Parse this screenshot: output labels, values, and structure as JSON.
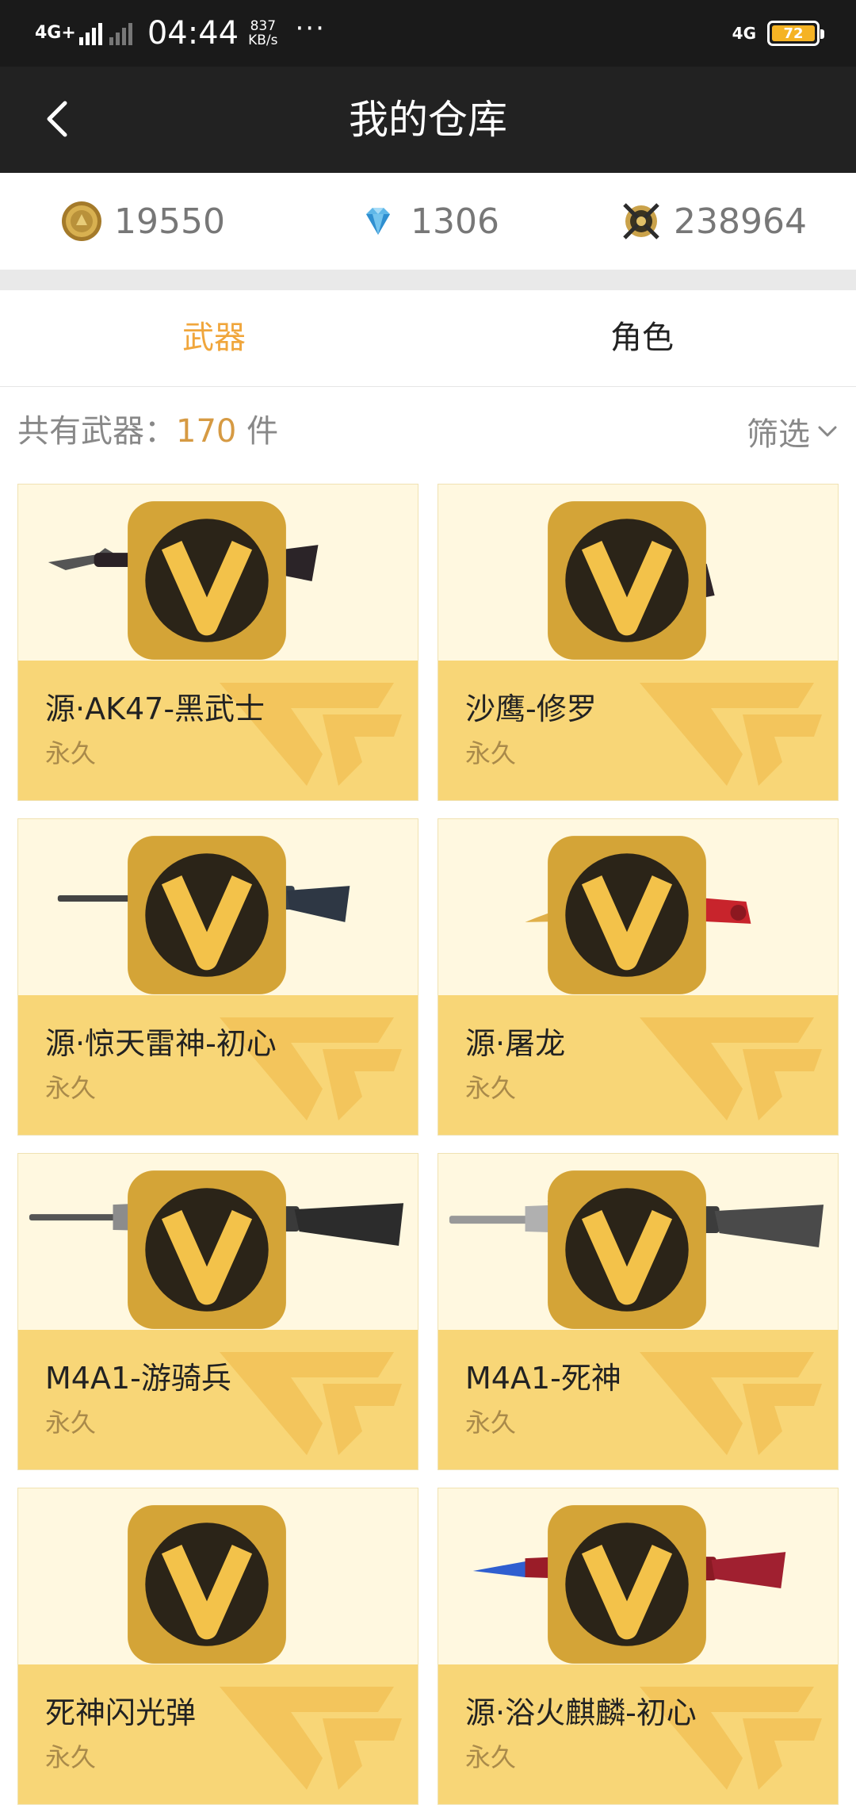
{
  "status_bar": {
    "network": "4G+",
    "time": "04:44",
    "speed_value": "837",
    "speed_unit": "KB/s",
    "dots": "···",
    "network_right": "4G",
    "battery": "72"
  },
  "header": {
    "title": "我的仓库",
    "back_icon": "chevron-left-icon"
  },
  "currency": [
    {
      "icon": "gold-coin-icon",
      "value": "19550"
    },
    {
      "icon": "diamond-icon",
      "value": "1306"
    },
    {
      "icon": "crossed-swords-emblem-icon",
      "value": "238964"
    }
  ],
  "tabs": [
    {
      "label": "武器",
      "active": true
    },
    {
      "label": "角色",
      "active": false
    }
  ],
  "summary": {
    "prefix": "共有武器：",
    "count": "170",
    "suffix": " 件"
  },
  "filter": {
    "label": "筛选",
    "icon": "chevron-down-icon"
  },
  "items": [
    {
      "name": "源·AK47-黑武士",
      "duration": "永久",
      "image": "rifle-icon"
    },
    {
      "name": "沙鹰-修罗",
      "duration": "永久",
      "image": "pistol-icon"
    },
    {
      "name": "源·惊天雷神-初心",
      "duration": "永久",
      "image": "rifle-icon"
    },
    {
      "name": "源·屠龙",
      "duration": "永久",
      "image": "knife-icon"
    },
    {
      "name": "M4A1-游骑兵",
      "duration": "永久",
      "image": "rifle-icon"
    },
    {
      "name": "M4A1-死神",
      "duration": "永久",
      "image": "rifle-icon"
    },
    {
      "name": "死神闪光弹",
      "duration": "永久",
      "image": "grenade-icon"
    },
    {
      "name": "源·浴火麒麟-初心",
      "duration": "永久",
      "image": "rifle-icon"
    }
  ],
  "colors": {
    "header_bg": "#222222",
    "tab_active": "#f0a63c",
    "card_info_bg": "#f8d677",
    "card_image_bg": "#fff8e0",
    "count_accent": "#d69a43"
  }
}
